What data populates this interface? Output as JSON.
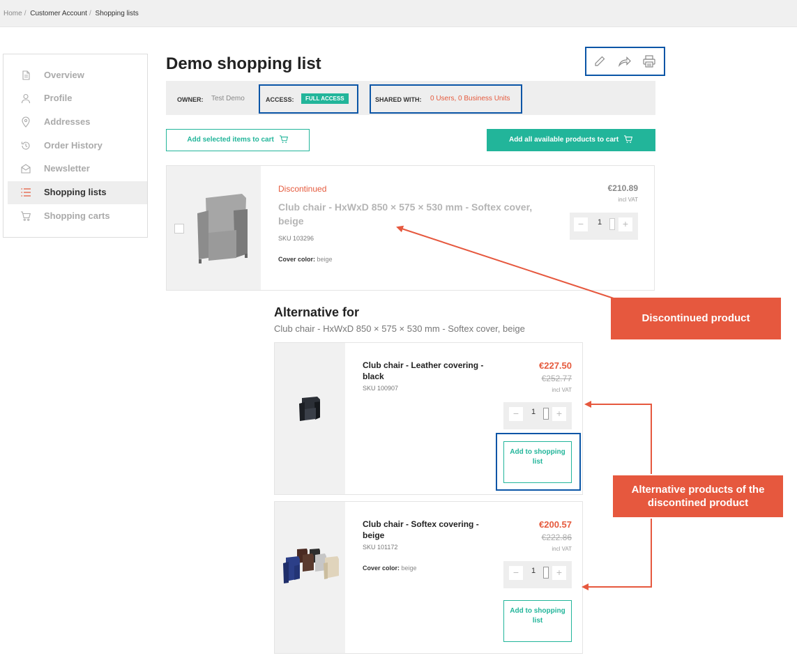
{
  "breadcrumb": [
    "Home",
    "Customer Account",
    "Shopping lists"
  ],
  "sidebar": {
    "items": [
      {
        "label": "Overview",
        "icon": "document-icon",
        "active": false
      },
      {
        "label": "Profile",
        "icon": "user-icon",
        "active": false
      },
      {
        "label": "Addresses",
        "icon": "map-pin-icon",
        "active": false
      },
      {
        "label": "Order History",
        "icon": "history-icon",
        "active": false
      },
      {
        "label": "Newsletter",
        "icon": "envelope-icon",
        "active": false
      },
      {
        "label": "Shopping lists",
        "icon": "list-icon",
        "active": true
      },
      {
        "label": "Shopping carts",
        "icon": "cart-icon",
        "active": false
      }
    ]
  },
  "page": {
    "title": "Demo shopping list",
    "actions": [
      "pencil-icon",
      "share-icon",
      "printer-icon"
    ]
  },
  "info": {
    "owner_label": "OWNER:",
    "owner_value": "Test Demo",
    "access_label": "ACCESS:",
    "access_badge": "FULL ACCESS",
    "shared_label": "SHARED WITH:",
    "shared_users": "0 Users",
    "shared_sep": ",",
    "shared_units": "0 Business Units"
  },
  "buttons": {
    "add_selected": "Add selected items to cart",
    "add_all": "Add all available products to cart"
  },
  "discontinued_item": {
    "status": "Discontinued",
    "name": "Club chair - HxWxD 850 × 575 × 530 mm - Softex cover, beige",
    "sku": "SKU 103296",
    "attr_label": "Cover color:",
    "attr_value": "beige",
    "price": "€210.89",
    "vat": "incl VAT",
    "quantity": "1"
  },
  "alternatives": {
    "title": "Alternative for",
    "subtitle": "Club chair - HxWxD 850 × 575 × 530 mm - Softex cover, beige",
    "items": [
      {
        "name": "Club chair - Leather covering - black",
        "sku": "SKU 100907",
        "price": "€227.50",
        "old_price": "€252.77",
        "vat": "incl VAT",
        "quantity": "1",
        "add_label": "Add to shopping list"
      },
      {
        "name": "Club chair - Softex covering - beige",
        "sku": "SKU 101172",
        "attr_label": "Cover color:",
        "attr_value": "beige",
        "price": "€200.57",
        "old_price": "€222.86",
        "vat": "incl VAT",
        "quantity": "1",
        "add_label": "Add to shopping list"
      }
    ]
  },
  "annotations": {
    "discontinued": "Discontinued product",
    "alternatives": "Alternative products of the discontined product"
  },
  "colors": {
    "accent": "#22b59a",
    "sale_red": "#e55a3d",
    "highlight_blue": "#0a55a6",
    "callout": "#e6583e"
  }
}
